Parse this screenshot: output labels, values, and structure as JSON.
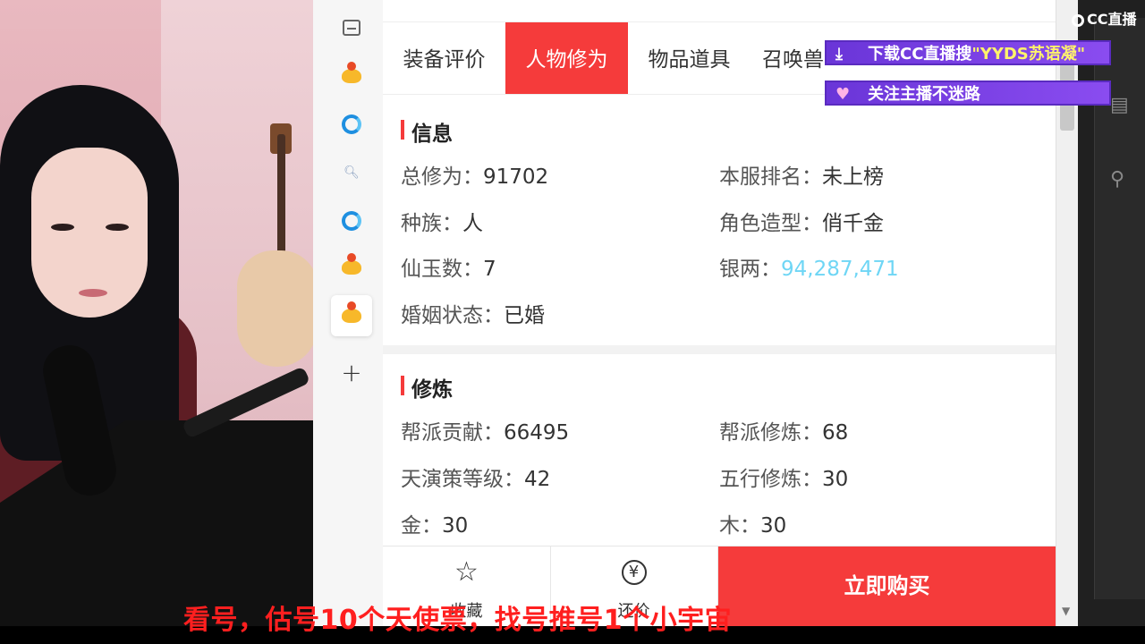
{
  "tabs": [
    "装备评价",
    "人物修为",
    "物品道具",
    "召唤兽"
  ],
  "info": {
    "title": "信息",
    "rows": [
      {
        "label": "总修为：",
        "value": "91702"
      },
      {
        "label": "本服排名：",
        "value": "未上榜"
      },
      {
        "label": "种族：",
        "value": "人"
      },
      {
        "label": "角色造型：",
        "value": "俏千金"
      },
      {
        "label": "仙玉数：",
        "value": "7"
      },
      {
        "label": "银两：",
        "value": "94,287,471"
      },
      {
        "label": "婚姻状态：",
        "value": "已婚"
      }
    ]
  },
  "training": {
    "title": "修炼",
    "rows": [
      {
        "label": "帮派贡献：",
        "value": "66495"
      },
      {
        "label": "帮派修炼：",
        "value": "68"
      },
      {
        "label": "天演策等级：",
        "value": "42"
      },
      {
        "label": "五行修炼：",
        "value": "30"
      },
      {
        "label": "金：",
        "value": "30"
      },
      {
        "label": "木：",
        "value": "30"
      }
    ]
  },
  "bottom": {
    "collect_label": "收藏",
    "bargain_label": "还价",
    "buy_label": "立即购买"
  },
  "overlay": {
    "logo": "CC直播",
    "banner1_prefix": "下载CC直播搜",
    "banner1_highlight": "\"YYDS苏语凝\"",
    "banner2": "关注主播不迷路",
    "subtitle": "看号，估号10个天使票，找号推号1个小宇宙"
  },
  "colors": {
    "accent": "#f53b3b",
    "money": "#6fd6f5",
    "banner": "#7b40e6",
    "subtitle": "#ff1f1f"
  },
  "icons": {
    "sidebar": [
      "window-icon",
      "chick-app-icon",
      "ce-browser-icon",
      "search-icon",
      "ce-browser-icon",
      "chick-app-icon",
      "chick-app-icon",
      "plus-icon"
    ],
    "bottom": [
      "star-icon",
      "yen-icon"
    ]
  }
}
